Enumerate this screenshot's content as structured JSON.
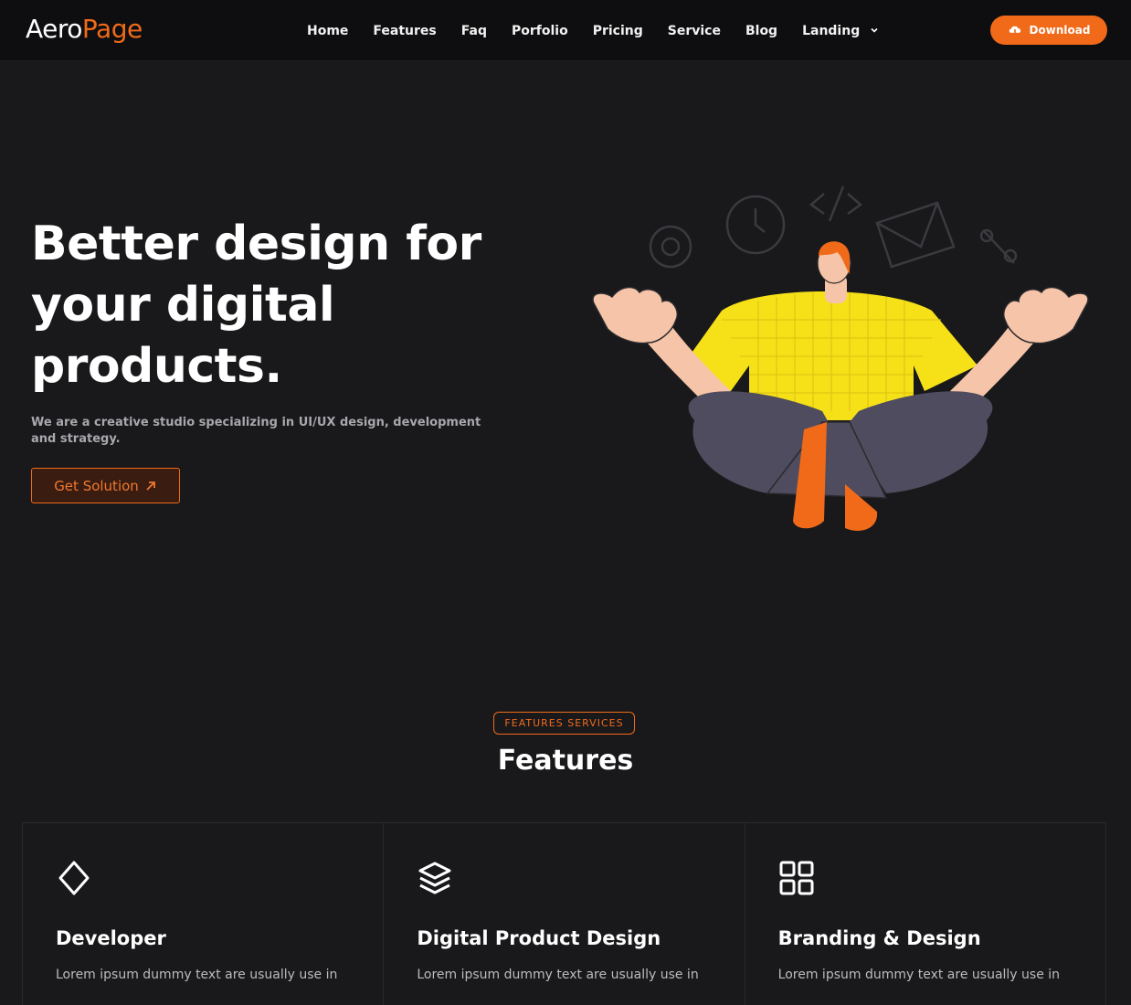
{
  "brand": {
    "part1": "Aero",
    "part2": "Page"
  },
  "nav": {
    "items": [
      "Home",
      "Features",
      "Faq",
      "Porfolio",
      "Pricing",
      "Service",
      "Blog",
      "Landing"
    ],
    "download_label": "Download"
  },
  "hero": {
    "title": "Better design for your digital products.",
    "subtitle": "We are a creative studio specializing in UI/UX design, development and strategy.",
    "cta_label": "Get Solution"
  },
  "features": {
    "badge": "FEATURES SERVICES",
    "title": "Features",
    "cards": [
      {
        "icon": "diamond-icon",
        "title": "Developer",
        "text": "Lorem ipsum dummy text are usually use in"
      },
      {
        "icon": "layers-icon",
        "title": "Digital Product Design",
        "text": "Lorem ipsum dummy text are usually use in"
      },
      {
        "icon": "grid-icon",
        "title": "Branding & Design",
        "text": "Lorem ipsum dummy text are usually use in"
      }
    ]
  },
  "colors": {
    "accent": "#f06a1a",
    "background": "#19191b",
    "nav_bg": "#0e0e10"
  }
}
